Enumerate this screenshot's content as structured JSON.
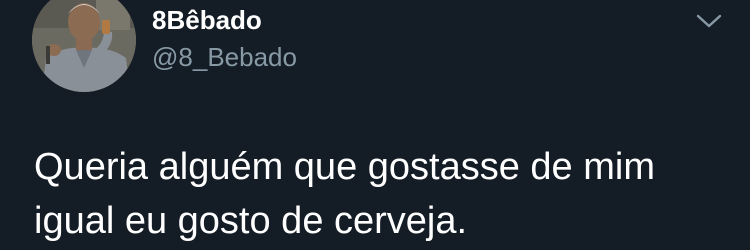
{
  "tweet": {
    "display_name": "8Bêbado",
    "handle": "@8_Bebado",
    "text_lines": [
      "Queria alguém que gostasse de mim",
      "igual eu gosto de cerveja."
    ],
    "menu_icon": "chevron-down-icon",
    "avatar": "avatar"
  },
  "colors": {
    "background": "#141d26",
    "text": "#ffffff",
    "secondary_text": "#8899a6"
  }
}
